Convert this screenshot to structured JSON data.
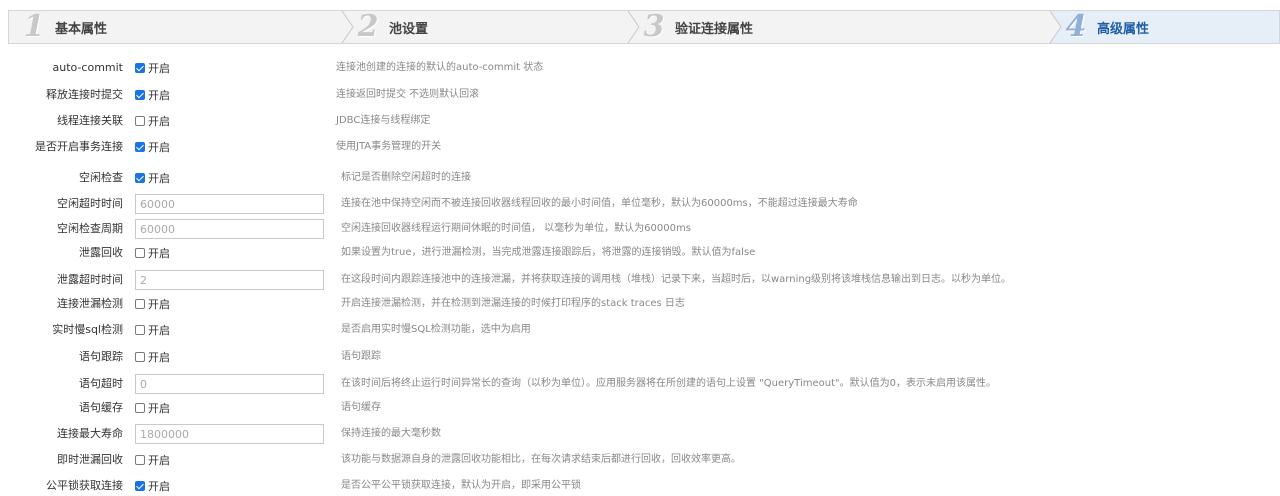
{
  "steps": [
    {
      "num": "1",
      "label": "基本属性",
      "active": false
    },
    {
      "num": "2",
      "label": "池设置",
      "active": false
    },
    {
      "num": "3",
      "label": "验证连接属性",
      "active": false
    },
    {
      "num": "4",
      "label": "高级属性",
      "active": true
    }
  ],
  "checkbox_text": "开启",
  "fields": [
    {
      "label": "auto-commit",
      "type": "checkbox",
      "checked": true,
      "desc": "连接池创建的连接的默认的auto-commit 状态"
    },
    {
      "label": "释放连接时提交",
      "type": "checkbox",
      "checked": true,
      "desc": "连接返回时提交 不选则默认回滚"
    },
    {
      "label": "线程连接关联",
      "type": "checkbox",
      "checked": false,
      "desc": "JDBC连接与线程绑定"
    },
    {
      "label": "是否开启事务连接",
      "type": "checkbox",
      "checked": true,
      "desc": "使用JTA事务管理的开关"
    },
    {
      "label": "空闲检查",
      "type": "checkbox",
      "checked": true,
      "desc": "标记是否删除空闲超时的连接"
    },
    {
      "label": "空闲超时时间",
      "type": "input",
      "value": "60000",
      "desc": "连接在池中保持空闲而不被连接回收器线程回收的最小时间值，单位毫秒，默认为60000ms，不能超过连接最大寿命"
    },
    {
      "label": "空闲检查周期",
      "type": "input",
      "value": "60000",
      "desc": "空闲连接回收器线程运行期间休眠的时间值， 以毫秒为单位，默认为60000ms"
    },
    {
      "label": "泄露回收",
      "type": "checkbox",
      "checked": false,
      "desc": "如果设置为true，进行泄漏检测，当完成泄露连接跟踪后，将泄露的连接销毁。默认值为false"
    },
    {
      "label": "泄露超时时间",
      "type": "input",
      "value": "2",
      "desc": "在这段时间内跟踪连接池中的连接泄漏，并将获取连接的调用栈（堆栈）记录下来，当超时后，以warning级别将该堆栈信息输出到日志。以秒为单位。"
    },
    {
      "label": "连接泄漏检测",
      "type": "checkbox",
      "checked": false,
      "desc": "开启连接泄漏检测，并在检测到泄漏连接的时候打印程序的stack traces 日志"
    },
    {
      "label": "实时慢sql检测",
      "type": "checkbox",
      "checked": false,
      "desc": "是否启用实时慢SQL检测功能，选中为启用"
    },
    {
      "label": "语句跟踪",
      "type": "checkbox",
      "checked": false,
      "desc": "语句跟踪"
    },
    {
      "label": "语句超时",
      "type": "input",
      "value": "0",
      "desc": "在该时间后将终止运行时间异常长的查询（以秒为单位）。应用服务器将在所创建的语句上设置 \"QueryTimeout\"。默认值为0，表示未启用该属性。"
    },
    {
      "label": "语句缓存",
      "type": "checkbox",
      "checked": false,
      "desc": "语句缓存"
    },
    {
      "label": "连接最大寿命",
      "type": "input",
      "value": "1800000",
      "desc": "保持连接的最大毫秒数"
    },
    {
      "label": "即时泄漏回收",
      "type": "checkbox",
      "checked": false,
      "desc": "该功能与数据源自身的泄露回收功能相比，在每次请求结束后都进行回收，回收效率更高。"
    },
    {
      "label": "公平锁获取连接",
      "type": "checkbox",
      "checked": true,
      "desc": "是否公平公平锁获取连接，默认为开启，即采用公平锁"
    }
  ],
  "colors": {
    "active_step_bg": "#e6eef7",
    "active_step_text": "#1f5fa8",
    "checkbox_on": "#1a73e8"
  }
}
